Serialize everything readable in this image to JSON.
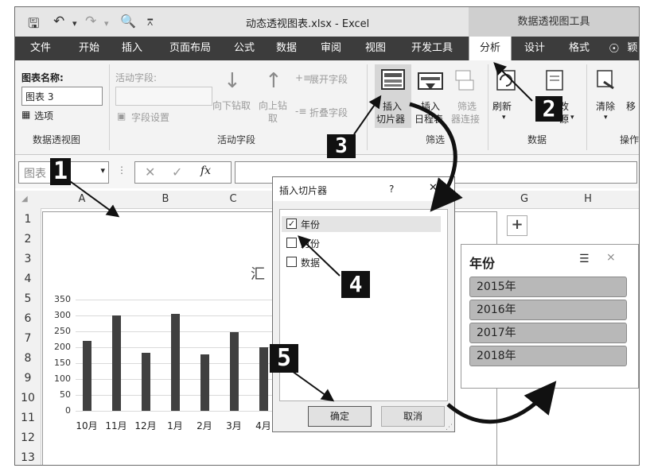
{
  "window": {
    "title": "动态透视图表.xlsx  -  Excel",
    "context_tab_group": "数据透视图工具",
    "tabs": [
      "文件",
      "开始",
      "插入",
      "页面布局",
      "公式",
      "数据",
      "审阅",
      "视图",
      "开发工具",
      "分析",
      "设计",
      "格式"
    ],
    "tab_overflow": "颖"
  },
  "ribbon": {
    "chart_name_label": "图表名称:",
    "chart_name_value": "图表 3",
    "options_label": "选项",
    "group_pivot_chart": "数据透视图",
    "active_field_label": "活动字段:",
    "field_settings": "字段设置",
    "drill_down": "向下钻取",
    "drill_up": "向上钻",
    "drill_up_2": "取",
    "expand_field": "展开字段",
    "collapse_field": "折叠字段",
    "group_active_field": "活动字段",
    "insert_slicer_1": "插入",
    "insert_slicer_2": "切片器",
    "insert_timeline_1": "插入",
    "insert_timeline_2": "日程表",
    "filter_conn_1": "筛选",
    "filter_conn_2": "器连接",
    "group_filter": "筛选",
    "refresh": "刷新",
    "change_source_1": "改",
    "change_source_2": "源",
    "group_data": "数据",
    "clear": "清除",
    "move": "移",
    "group_actions": "操作"
  },
  "formula_bar": {
    "name_box": "图表",
    "fx": "fx"
  },
  "columns": [
    "A",
    "B",
    "C",
    "G",
    "H"
  ],
  "rows": [
    "1",
    "2",
    "3",
    "4",
    "5",
    "6",
    "7",
    "8",
    "9",
    "10",
    "11",
    "12",
    "13"
  ],
  "chart_title_partial": "汇",
  "chart_data": {
    "type": "bar",
    "categories": [
      "10月",
      "11月",
      "12月",
      "1月",
      "2月",
      "3月",
      "4月"
    ],
    "values": [
      220,
      300,
      183,
      305,
      178,
      247,
      200
    ],
    "ylim": [
      0,
      350
    ],
    "yticks": [
      "0",
      "50",
      "100",
      "150",
      "200",
      "250",
      "300",
      "350"
    ],
    "grid": true
  },
  "dialog": {
    "title": "插入切片器",
    "help": "?",
    "fields": [
      {
        "label": "年份",
        "checked": true
      },
      {
        "label": "月份",
        "checked": false
      },
      {
        "label": "数据",
        "checked": false
      }
    ],
    "ok": "确定",
    "cancel": "取消"
  },
  "slicer": {
    "title": "年份",
    "items": [
      "2015年",
      "2016年",
      "2017年",
      "2018年"
    ]
  },
  "callouts": [
    "1",
    "2",
    "3",
    "4",
    "5"
  ]
}
